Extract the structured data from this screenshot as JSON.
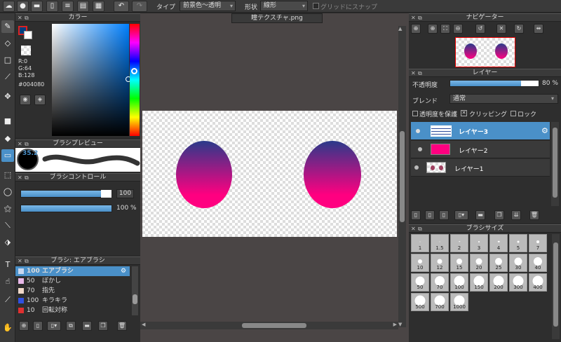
{
  "toolbar": {
    "type_label": "タイプ",
    "type_value": "前景色～透明",
    "shape_label": "形状",
    "shape_value": "線形",
    "grid_snap": "グリッドにスナップ"
  },
  "color_panel": {
    "title": "カラー",
    "r": "R:0",
    "g": "G:64",
    "b": "B:128",
    "hex": "#004080"
  },
  "brush_preview": {
    "title": "ブラシプレビュー",
    "size": "35.2"
  },
  "brush_control": {
    "title": "ブラシコントロール",
    "size_value": "100",
    "opacity_value": "100 %"
  },
  "brush_list": {
    "title": "ブラシ: エアブラシ",
    "items": [
      {
        "size": "100",
        "name": "エアブラシ",
        "color": "#c8d8f0"
      },
      {
        "size": "50",
        "name": "ぼかし",
        "color": "#e8b8e8"
      },
      {
        "size": "70",
        "name": "指先",
        "color": "#f0d8c8"
      },
      {
        "size": "100",
        "name": "キラキラ",
        "color": "#3050e0"
      },
      {
        "size": "10",
        "name": "回転対称",
        "color": "#e03030"
      }
    ]
  },
  "canvas": {
    "tab": "瞳テクスチャ.png"
  },
  "navigator": {
    "title": "ナビゲーター"
  },
  "layers": {
    "title": "レイヤー",
    "opacity_label": "不透明度",
    "opacity_value": "80 %",
    "opacity": 0.8,
    "blend_label": "ブレンド",
    "blend_value": "通常",
    "protect_label": "透明度を保護",
    "clip_label": "クリッピング",
    "lock_label": "ロック",
    "items": [
      {
        "name": "レイヤー3"
      },
      {
        "name": "レイヤー2"
      },
      {
        "name": "レイヤー1"
      }
    ]
  },
  "brush_size": {
    "title": "ブラシサイズ",
    "sizes": [
      "1",
      "1.5",
      "2",
      "3",
      "4",
      "5",
      "7",
      "10",
      "12",
      "15",
      "20",
      "25",
      "30",
      "40",
      "50",
      "70",
      "100",
      "150",
      "200",
      "300",
      "400",
      "500",
      "700",
      "1000"
    ]
  },
  "colors": {
    "fg": "#004080",
    "accent": "#4a90c8",
    "gradient_top": "#2a3a8a",
    "gradient_bottom": "#ff0080"
  }
}
